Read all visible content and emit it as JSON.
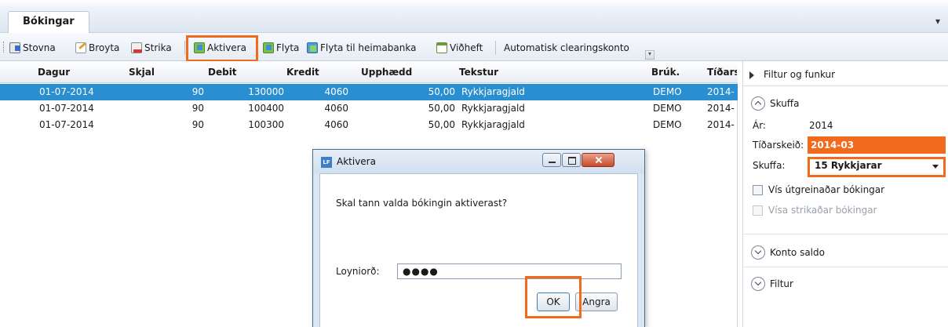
{
  "tabs": [
    {
      "label": "Bókingar"
    }
  ],
  "tab_menu_glyph": "▾",
  "toolbar": {
    "new_label": "Stovna",
    "edit_label": "Broyta",
    "delete_label": "Strika",
    "activate_label": "Aktivera",
    "move_label": "Flyta",
    "move_bank_label": "Flyta til heimabanka",
    "attach_label": "Viðheft",
    "auto_clearing_label": "Automatisk clearingskonto",
    "highlight_color": "#f26a1b"
  },
  "grid": {
    "columns": [
      "Dagur",
      "Skjal",
      "Debit",
      "Kredit",
      "Upphædd",
      "Tekstur",
      "Brúk.",
      "Tíðars"
    ],
    "rows": [
      {
        "dagur": "01-07-2014",
        "skjal": "90",
        "debit": "130000",
        "kredit": "4060",
        "upphaedd": "50,00",
        "tekstur": "Rykkjaragjald",
        "bruk": "DEMO",
        "tidars": "2014-",
        "selected": true
      },
      {
        "dagur": "01-07-2014",
        "skjal": "90",
        "debit": "100400",
        "kredit": "4060",
        "upphaedd": "50,00",
        "tekstur": "Rykkjaragjald",
        "bruk": "DEMO",
        "tidars": "2014-",
        "selected": false
      },
      {
        "dagur": "01-07-2014",
        "skjal": "90",
        "debit": "100300",
        "kredit": "4060",
        "upphaedd": "50,00",
        "tekstur": "Rykkjaragjald",
        "bruk": "DEMO",
        "tidars": "2014-",
        "selected": false
      }
    ],
    "selected_color": "#2a8fd0"
  },
  "side": {
    "header": "Filtur og funkur",
    "section_skuffa": "Skuffa",
    "ar_label": "Ár:",
    "ar_value": "2014",
    "period_label": "Tíðarskeið:",
    "period_value": "2014-03",
    "skuffa_label": "Skuffa:",
    "skuffa_value": "15 Rykkjarar",
    "cb_breakdown": "Vís útgreinaðar bókingar",
    "cb_deleted": "Vísa strikaðar bókingar",
    "section_saldo": "Konto saldo",
    "section_filtur": "Filtur"
  },
  "dialog": {
    "logo": "LF",
    "title": "Aktivera",
    "question": "Skal tann valda bókingin aktiverast?",
    "password_label": "Loyniorð:",
    "password_value": "●●●●",
    "ok_label": "OK",
    "cancel_label": "Angra"
  }
}
